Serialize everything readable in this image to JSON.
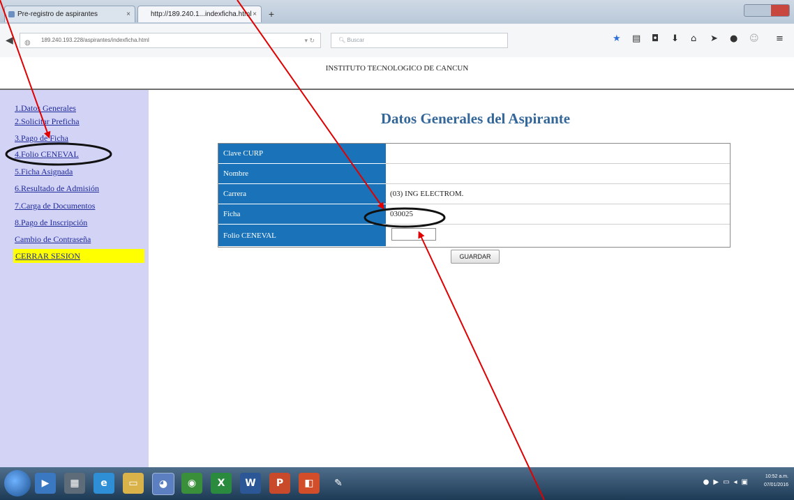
{
  "browser": {
    "tabs": [
      {
        "label": "Pre-registro de aspirantes"
      },
      {
        "label": "http://189.240.1...indexficha.html"
      }
    ],
    "new_tab": "+",
    "url": "189.240.193.228/aspirantes/indexficha.html",
    "search_placeholder": "Buscar",
    "toolbar_icons": [
      "star-icon",
      "reading-list-icon",
      "pocket-icon",
      "download-icon",
      "home-icon",
      "send-icon",
      "chat-icon",
      "smiley-icon",
      "menu-icon"
    ]
  },
  "header": {
    "institution": "INSTITUTO TECNOLOGICO DE CANCUN"
  },
  "sidebar": {
    "items": [
      {
        "label": "1.Datos Generales"
      },
      {
        "label": "2.Solicitar Preficha"
      },
      {
        "label": "3.Pago de Ficha"
      },
      {
        "label": "4.Folio CENEVAL"
      },
      {
        "label": "5.Ficha Asignada"
      },
      {
        "label": "6.Resultado de Admisión"
      },
      {
        "label": "7.Carga de Documentos"
      },
      {
        "label": "8.Pago de Inscripción"
      },
      {
        "label": "Cambio de Contraseña"
      }
    ],
    "logout": "CERRAR SESION",
    "accent": "#ffff00"
  },
  "main": {
    "title": "Datos Generales del Aspirante",
    "fields": [
      {
        "label": "Clave CURP",
        "value": ""
      },
      {
        "label": "Nombre",
        "value": ""
      },
      {
        "label": "Carrera",
        "value": "(03) ING ELECTROM."
      },
      {
        "label": "Ficha",
        "value": "030025"
      },
      {
        "label": "Folio CENEVAL",
        "value": ""
      }
    ],
    "save_label": "GUARDAR",
    "header_color": "#1a73b8"
  },
  "taskbar": {
    "clock_time": "10:52 a.m.",
    "clock_date": "07/01/2016"
  },
  "annotation_color": "#e00000"
}
